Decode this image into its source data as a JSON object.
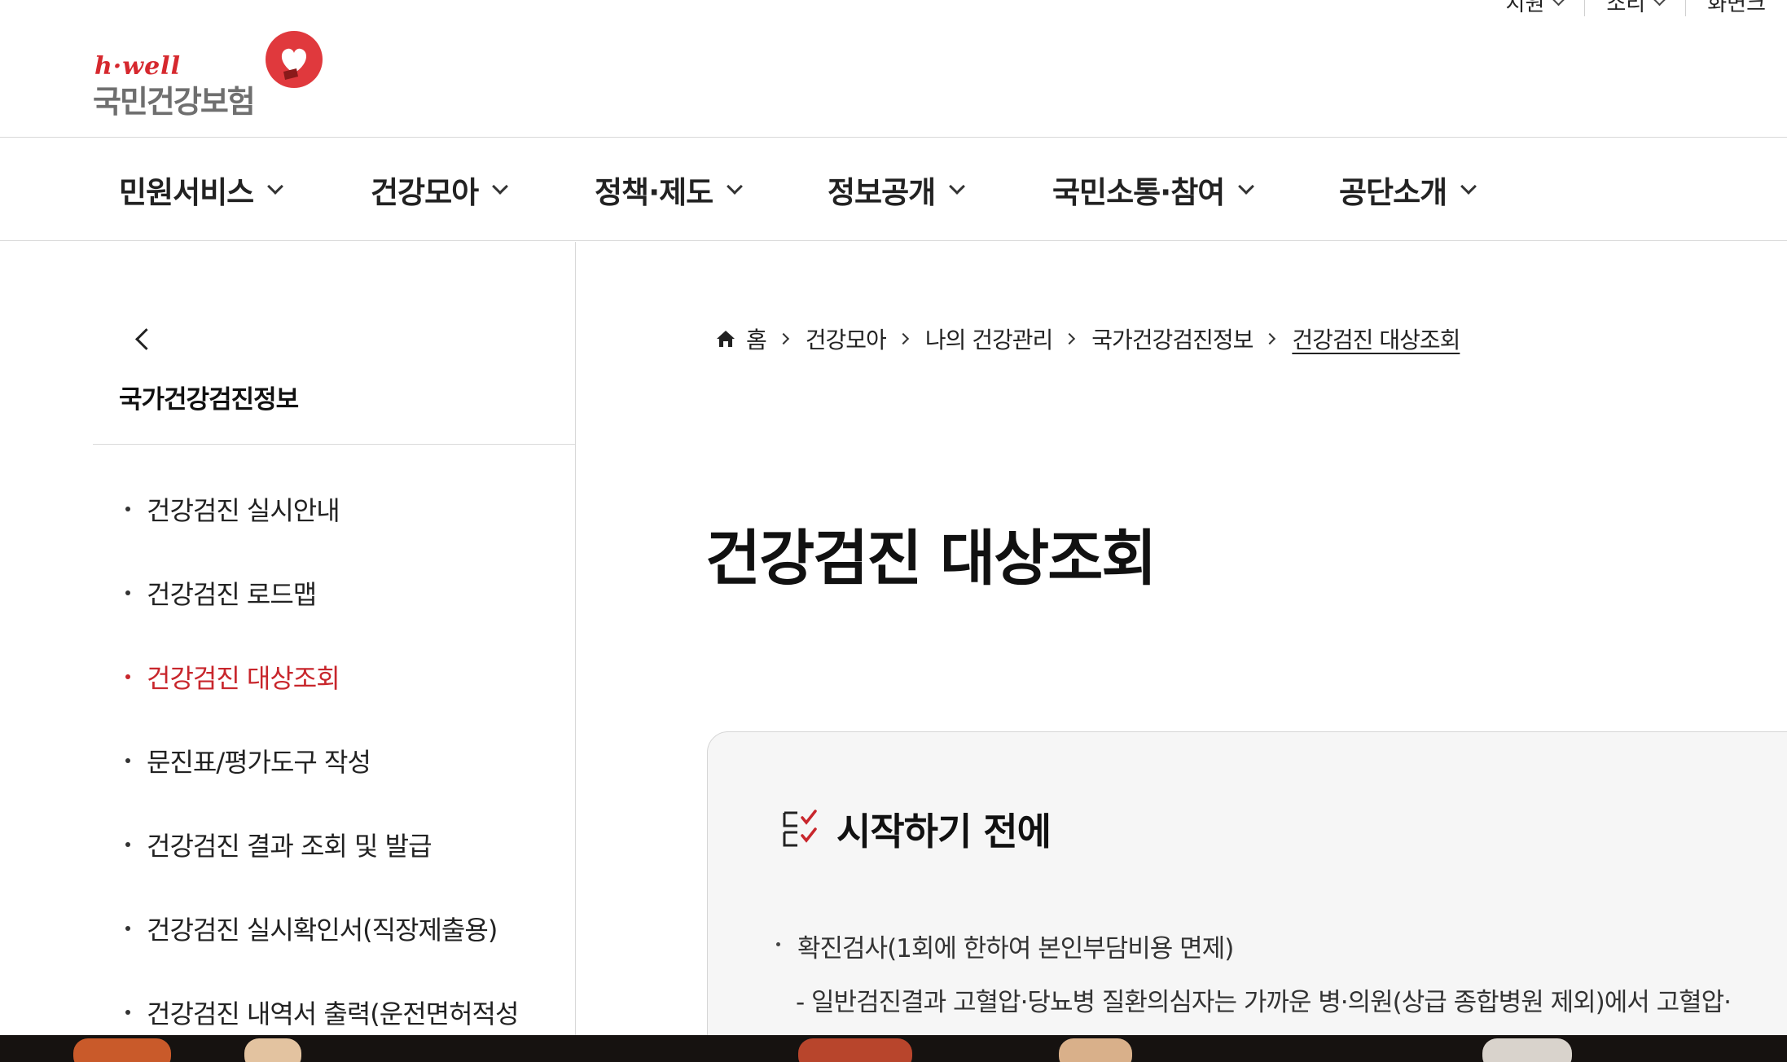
{
  "utility": [
    {
      "label": "지원"
    },
    {
      "label": "소리"
    },
    {
      "label": "화면크"
    }
  ],
  "logo": {
    "brand": "h·well",
    "name": "국민건강보험"
  },
  "gnb": [
    {
      "label": "민원서비스"
    },
    {
      "label": "건강모아"
    },
    {
      "label": "정책·제도"
    },
    {
      "label": "정보공개"
    },
    {
      "label": "국민소통·참여"
    },
    {
      "label": "공단소개"
    }
  ],
  "lnb": {
    "title": "국가건강검진정보",
    "items": [
      {
        "label": "건강검진 실시안내"
      },
      {
        "label": "건강검진 로드맵"
      },
      {
        "label": "건강검진 대상조회"
      },
      {
        "label": "문진표/평가도구 작성"
      },
      {
        "label": "건강검진 결과 조회 및 발급"
      },
      {
        "label": "건강검진 실시확인서(직장제출용)"
      },
      {
        "label": "건강검진 내역서 출력(운전면허적성"
      }
    ],
    "active_index": 2
  },
  "breadcrumb": [
    "홈",
    "건강모아",
    "나의 건강관리",
    "국가건강검진정보",
    "건강검진 대상조회"
  ],
  "page": {
    "title": "건강검진 대상조회"
  },
  "notice": {
    "title": "시작하기 전에",
    "bullet": "확진검사(1회에 한하여 본인부담비용 면제)",
    "sub": "- 일반검진결과 고혈압·당뇨병 질환의심자는 가까운 병·의원(상급 종합병원 제외)에서 고혈압·"
  },
  "colors": {
    "accent": "#c8262c",
    "logo_red": "#d6282e",
    "logo_gray": "#6f6f6f"
  }
}
